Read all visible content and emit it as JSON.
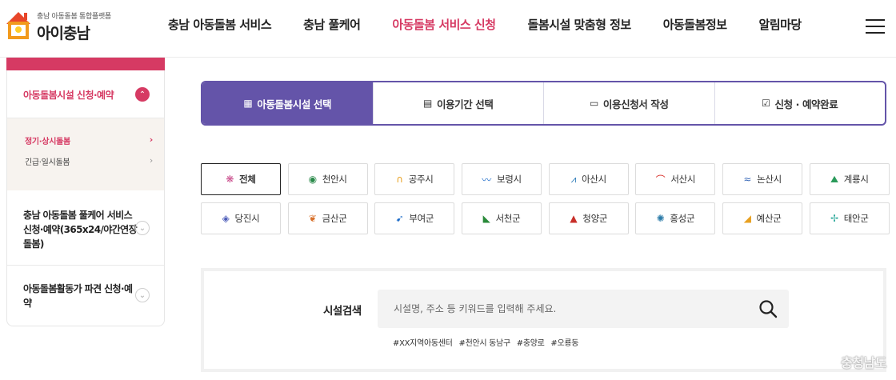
{
  "header": {
    "logo_sub": "충남 아동돌봄 통합플랫폼",
    "logo_main": "아이충남",
    "nav": [
      {
        "label": "충남 아동돌봄 서비스"
      },
      {
        "label": "충남 풀케어"
      },
      {
        "label": "아동돌봄 서비스 신청"
      },
      {
        "label": "돌봄시설 맞춤형 정보"
      },
      {
        "label": "아동돌봄정보"
      },
      {
        "label": "알림마당"
      }
    ],
    "active_index": 2
  },
  "sidebar": {
    "section1_title": "아동돌봄시설 신청·예약",
    "sub_items": [
      {
        "label": "정기·상시돌봄"
      },
      {
        "label": "긴급·일시돌봄"
      }
    ],
    "section2_title": "충남 아동돌봄 풀케어 서비스 신청·예약(365x24/야간연장돌봄)",
    "section3_title": "아동돌봄활동가 파견 신청·예약"
  },
  "steps": [
    {
      "label": "아동돌봄시설 선택",
      "icon": "building-icon"
    },
    {
      "label": "이용기간 선택",
      "icon": "calendar-icon"
    },
    {
      "label": "이용신청서 작성",
      "icon": "form-icon"
    },
    {
      "label": "신청 · 예약완료",
      "icon": "check-circle-icon"
    }
  ],
  "regions": [
    {
      "label": "전체"
    },
    {
      "label": "천안시"
    },
    {
      "label": "공주시"
    },
    {
      "label": "보령시"
    },
    {
      "label": "아산시"
    },
    {
      "label": "서산시"
    },
    {
      "label": "논산시"
    },
    {
      "label": "계룡시"
    },
    {
      "label": "당진시"
    },
    {
      "label": "금산군"
    },
    {
      "label": "부여군"
    },
    {
      "label": "서천군"
    },
    {
      "label": "청양군"
    },
    {
      "label": "홍성군"
    },
    {
      "label": "예산군"
    },
    {
      "label": "태안군"
    }
  ],
  "search": {
    "label": "시설검색",
    "placeholder": "시설명, 주소 등 키워드를 입력해 주세요.",
    "tags": [
      "#XX지역아동센터",
      "#천안시 동남구",
      "#충양로",
      "#오룡동"
    ]
  },
  "watermark": "충청남도",
  "colors": {
    "accent": "#d63a63",
    "step_active": "#6454a9"
  }
}
